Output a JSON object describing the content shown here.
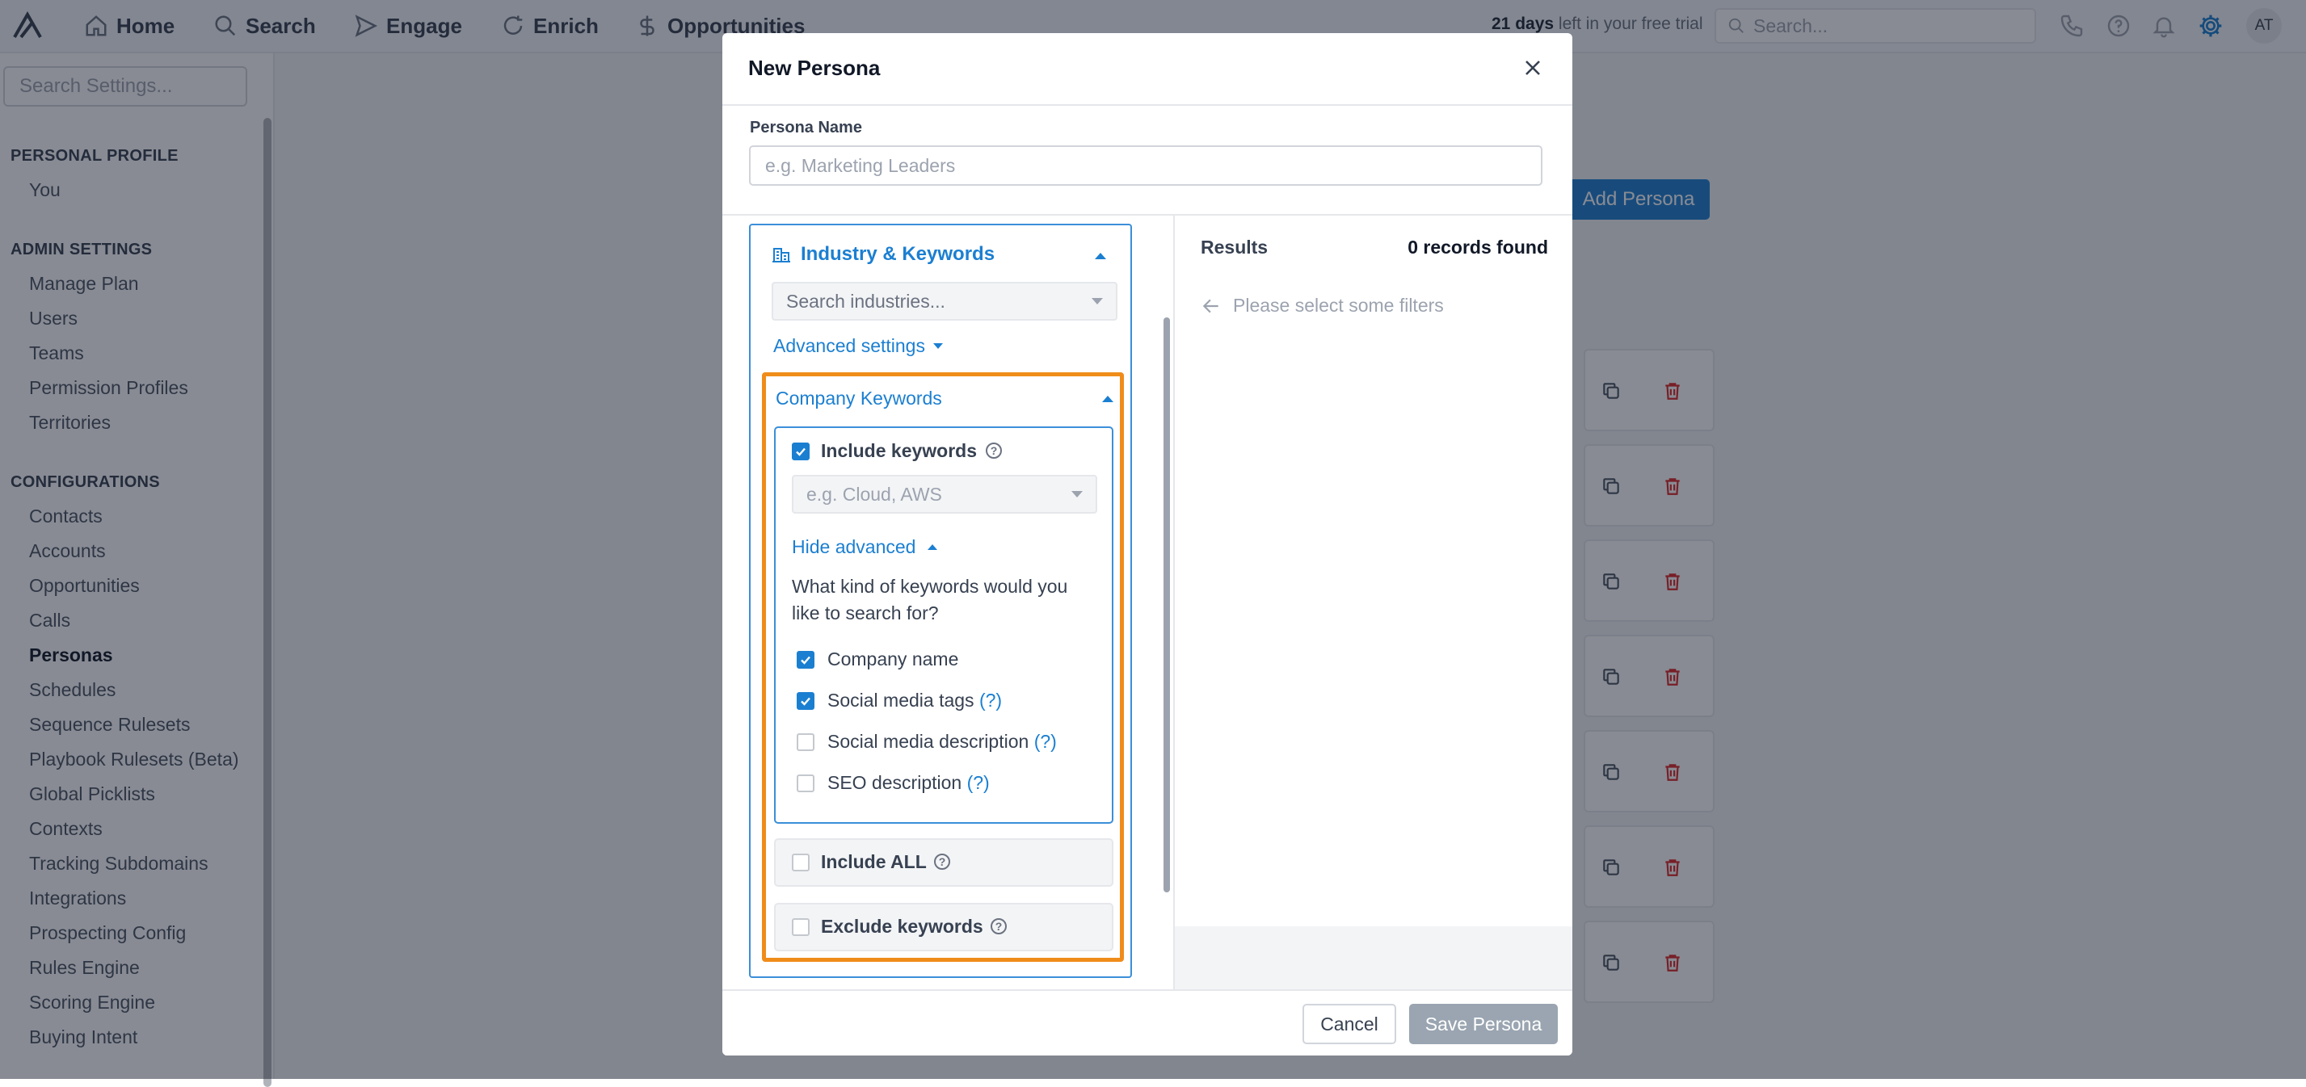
{
  "nav": {
    "items": [
      {
        "label": "Home",
        "icon": "home-icon"
      },
      {
        "label": "Search",
        "icon": "search-icon"
      },
      {
        "label": "Engage",
        "icon": "send-icon"
      },
      {
        "label": "Enrich",
        "icon": "refresh-icon"
      },
      {
        "label": "Opportunities",
        "icon": "dollar-icon"
      }
    ],
    "trial_days": "21 days",
    "trial_rest": "left in your free trial",
    "search_placeholder": "Search...",
    "avatar_initials": "AT"
  },
  "sidebar": {
    "search_placeholder": "Search Settings...",
    "personal_heading": "PERSONAL PROFILE",
    "personal_items": [
      "You"
    ],
    "admin_heading": "ADMIN SETTINGS",
    "admin_items": [
      "Manage Plan",
      "Users",
      "Teams",
      "Permission Profiles",
      "Territories"
    ],
    "config_heading": "CONFIGURATIONS",
    "config_items": [
      "Contacts",
      "Accounts",
      "Opportunities",
      "Calls",
      "Personas",
      "Schedules",
      "Sequence Rulesets",
      "Playbook Rulesets (Beta)",
      "Global Picklists",
      "Contexts",
      "Tracking Subdomains",
      "Integrations",
      "Prospecting Config",
      "Rules Engine",
      "Scoring Engine",
      "Buying Intent"
    ],
    "active_item": "Personas"
  },
  "main": {
    "add_persona_label": "Add Persona"
  },
  "modal": {
    "title": "New Persona",
    "persona_name_label": "Persona Name",
    "persona_name_placeholder": "e.g. Marketing Leaders",
    "persona_name_value": "",
    "industry": {
      "heading": "Industry & Keywords",
      "search_placeholder": "Search industries...",
      "advanced_settings": "Advanced settings"
    },
    "company_keywords": {
      "heading": "Company Keywords",
      "include_label": "Include keywords",
      "include_checked": true,
      "keywords_placeholder": "e.g. Cloud, AWS",
      "hide_advanced": "Hide advanced",
      "question": "What kind of keywords would you like to search for?",
      "options": [
        {
          "label": "Company name",
          "checked": true,
          "help": ""
        },
        {
          "label": "Social media tags",
          "checked": true,
          "help": "(?)"
        },
        {
          "label": "Social media description",
          "checked": false,
          "help": "(?)"
        },
        {
          "label": "SEO description",
          "checked": false,
          "help": "(?)"
        }
      ],
      "include_all_label": "Include ALL",
      "include_all_checked": false,
      "exclude_label": "Exclude keywords",
      "exclude_checked": false
    },
    "results": {
      "label": "Results",
      "count_text": "0 records found",
      "hint": "Please select some filters"
    },
    "cancel_label": "Cancel",
    "save_label": "Save Persona"
  },
  "colors": {
    "accent": "#1b7fd1",
    "highlight": "#f08c1a",
    "delete": "#dc2626",
    "save_disabled": "#9aa5b1"
  }
}
